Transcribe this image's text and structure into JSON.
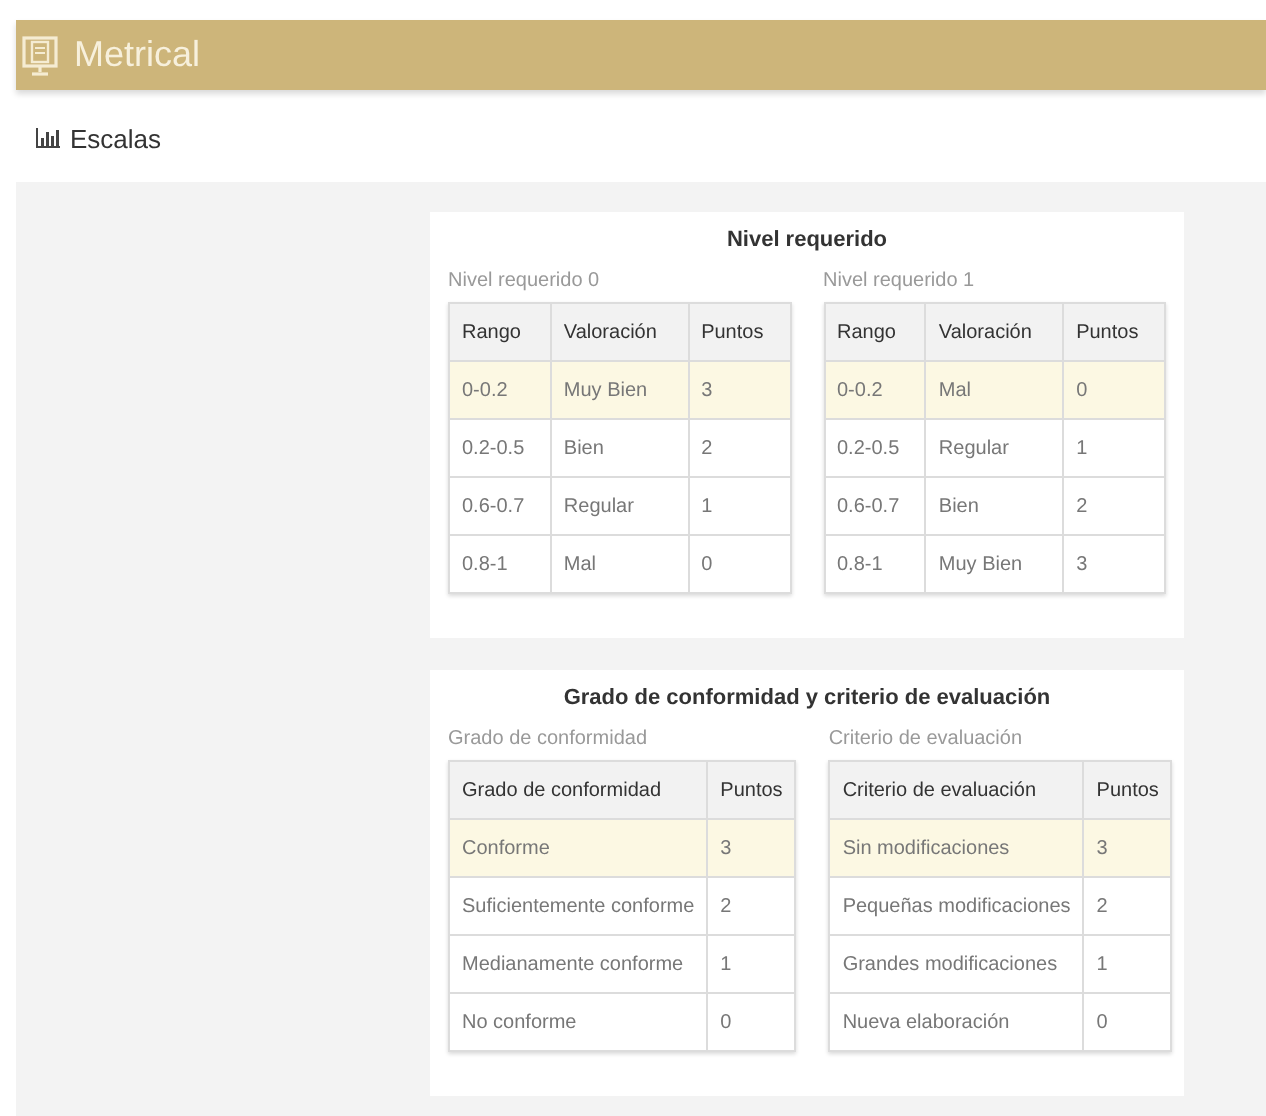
{
  "app": {
    "title": "Metrical"
  },
  "page": {
    "heading": "Escalas"
  },
  "panels": [
    {
      "title": "Nivel requerido",
      "tables": [
        {
          "caption": "Nivel requerido 0",
          "columns": [
            "Rango",
            "Valoración",
            "Puntos"
          ],
          "rows": [
            {
              "cells": [
                "0-0.2",
                "Muy Bien",
                "3"
              ],
              "highlighted": true
            },
            {
              "cells": [
                "0.2-0.5",
                "Bien",
                "2"
              ],
              "highlighted": false
            },
            {
              "cells": [
                "0.6-0.7",
                "Regular",
                "1"
              ],
              "highlighted": false
            },
            {
              "cells": [
                "0.8-1",
                "Mal",
                "0"
              ],
              "highlighted": false
            }
          ]
        },
        {
          "caption": "Nivel requerido 1",
          "columns": [
            "Rango",
            "Valoración",
            "Puntos"
          ],
          "rows": [
            {
              "cells": [
                "0-0.2",
                "Mal",
                "0"
              ],
              "highlighted": true
            },
            {
              "cells": [
                "0.2-0.5",
                "Regular",
                "1"
              ],
              "highlighted": false
            },
            {
              "cells": [
                "0.6-0.7",
                "Bien",
                "2"
              ],
              "highlighted": false
            },
            {
              "cells": [
                "0.8-1",
                "Muy Bien",
                "3"
              ],
              "highlighted": false
            }
          ]
        }
      ]
    },
    {
      "title": "Grado de conformidad y criterio de evaluación",
      "tables": [
        {
          "caption": "Grado de conformidad",
          "columns": [
            "Grado de conformidad",
            "Puntos"
          ],
          "rows": [
            {
              "cells": [
                "Conforme",
                "3"
              ],
              "highlighted": true
            },
            {
              "cells": [
                "Suficientemente conforme",
                "2"
              ],
              "highlighted": false
            },
            {
              "cells": [
                "Medianamente conforme",
                "1"
              ],
              "highlighted": false
            },
            {
              "cells": [
                "No conforme",
                "0"
              ],
              "highlighted": false
            }
          ]
        },
        {
          "caption": "Criterio de evaluación",
          "columns": [
            "Criterio de evaluación",
            "Puntos"
          ],
          "rows": [
            {
              "cells": [
                "Sin modificaciones",
                "3"
              ],
              "highlighted": true
            },
            {
              "cells": [
                "Pequeñas modificaciones",
                "2"
              ],
              "highlighted": false
            },
            {
              "cells": [
                "Grandes modificaciones",
                "1"
              ],
              "highlighted": false
            },
            {
              "cells": [
                "Nueva elaboración",
                "0"
              ],
              "highlighted": false
            }
          ]
        }
      ]
    }
  ]
}
